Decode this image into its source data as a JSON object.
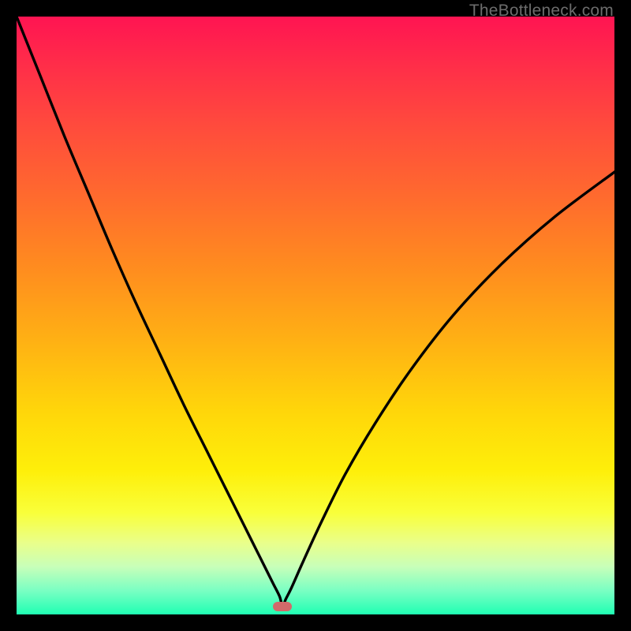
{
  "watermark": "TheBottleneck.com",
  "colors": {
    "frame": "#000000",
    "curve": "#000000",
    "marker": "#d26a6a"
  },
  "chart_data": {
    "type": "line",
    "title": "",
    "xlabel": "",
    "ylabel": "",
    "xlim": [
      0,
      100
    ],
    "ylim": [
      0,
      100
    ],
    "min_point": {
      "x": 44.5,
      "y": 1.3
    },
    "series": [
      {
        "name": "bottleneck-curve",
        "x": [
          0,
          4,
          8,
          12,
          16,
          20,
          24,
          28,
          32,
          35,
          38,
          40,
          42,
          43,
          44,
          44.5,
          45,
          46,
          48,
          51,
          55,
          60,
          66,
          73,
          81,
          90,
          100
        ],
        "values": [
          100,
          90,
          80,
          70.5,
          61,
          52,
          43.5,
          35,
          27,
          21,
          15,
          11,
          7,
          5,
          3,
          1.3,
          2.5,
          4.5,
          9,
          15.5,
          23.5,
          32,
          41,
          50,
          58.5,
          66.5,
          74
        ]
      }
    ]
  }
}
